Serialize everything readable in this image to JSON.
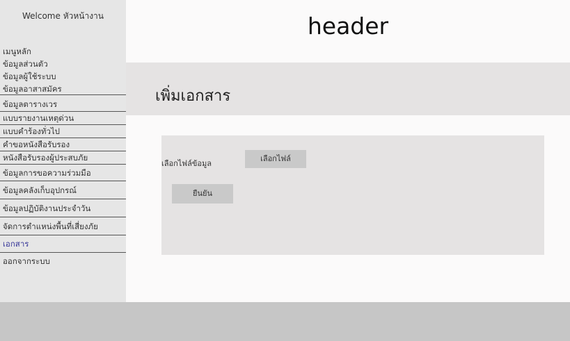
{
  "sidebar": {
    "welcome": "Welcome หัวหน้างาน",
    "items": [
      {
        "label": "เมนูหลัก"
      },
      {
        "label": "ข้อมูลส่วนตัว"
      },
      {
        "label": "ข้อมูลผู้ใช้ระบบ"
      },
      {
        "label": "ข้อมูลอาสาสมัคร"
      },
      {
        "label": "ข้อมูลตารางเวร"
      },
      {
        "label": "แบบรายงานเหตุด่วน"
      },
      {
        "label": "แบบคำร้องทั่วไป"
      },
      {
        "label": "คำขอหนังสือรับรอง"
      },
      {
        "label": "หนังสือรับรองผู้ประสบภัย"
      },
      {
        "label": "ข้อมูลการขอความร่วมมือ"
      },
      {
        "label": "ข้อมูลคลังเก็บอุปกรณ์"
      },
      {
        "label": "ข้อมูลปฏิบัติงานประจำวัน"
      },
      {
        "label": "จัดการตำแหน่งพื้นที่เสี่ยงภัย"
      },
      {
        "label": "เอกสาร"
      },
      {
        "label": "ออกจากระบบ"
      }
    ]
  },
  "header": {
    "title": "header"
  },
  "main": {
    "page_title": "เพิ่มเอกสาร",
    "file_label": "เลือกไฟล์ข้อมูล",
    "choose_button": "เลือกไฟล์",
    "confirm_button": "ยืนยัน"
  }
}
